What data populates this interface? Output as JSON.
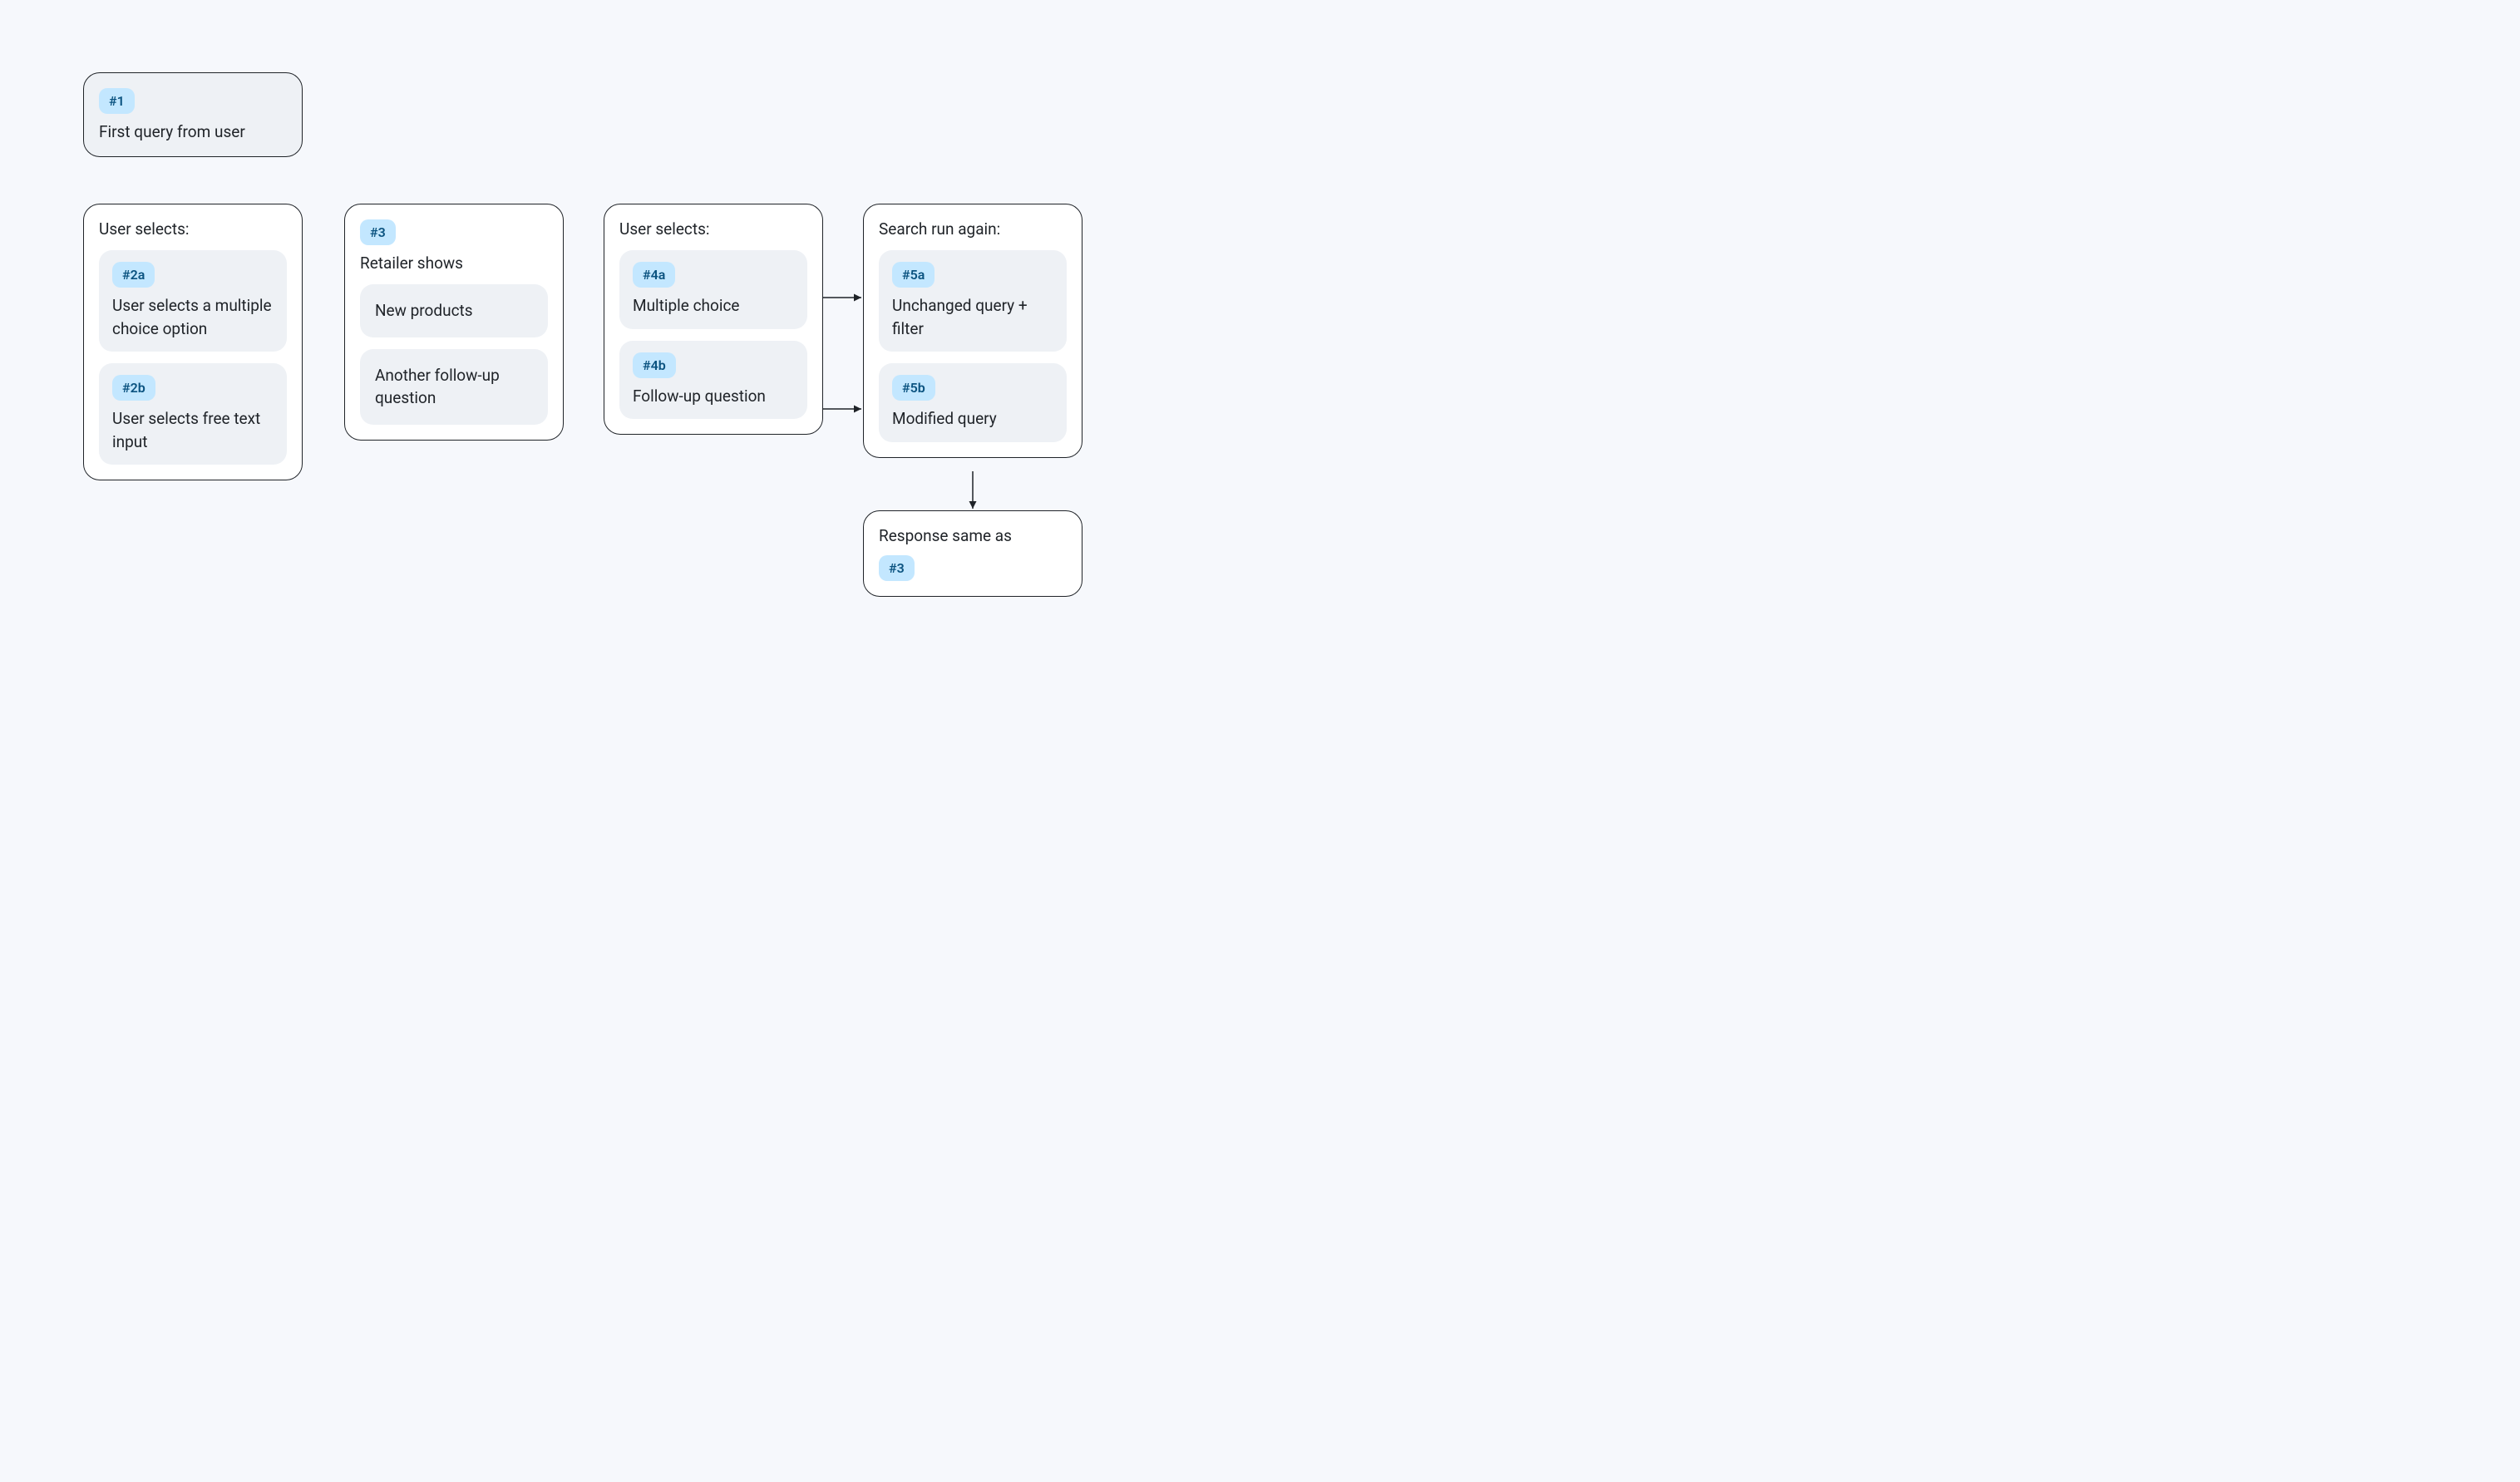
{
  "box1": {
    "tag": "#1",
    "text": "First query from user"
  },
  "box2": {
    "title": "User selects:",
    "a": {
      "tag": "#2a",
      "text": "User selects a multiple choice option"
    },
    "b": {
      "tag": "#2b",
      "text": "User selects free text input"
    }
  },
  "box3": {
    "tag": "#3",
    "title": "Retailer shows",
    "sub1": "New products",
    "sub2": "Another follow-up question"
  },
  "box4": {
    "title": "User selects:",
    "a": {
      "tag": "#4a",
      "text": "Multiple choice"
    },
    "b": {
      "tag": "#4b",
      "text": "Follow-up question"
    }
  },
  "box5": {
    "title": "Search run again:",
    "a": {
      "tag": "#5a",
      "text": "Unchanged query + filter"
    },
    "b": {
      "tag": "#5b",
      "text": "Modified query"
    }
  },
  "box6": {
    "title": "Response same as",
    "tag": "#3"
  }
}
